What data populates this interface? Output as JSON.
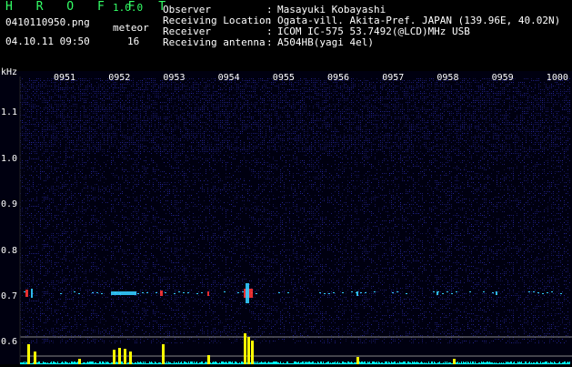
{
  "header": {
    "app_title": "H R O F F T",
    "version": "1.0.0",
    "filename": "0410110950.png",
    "datetime": "04.10.11 09:50",
    "meteor_label": "meteor",
    "meteor_count": "16"
  },
  "metadata": [
    {
      "key": "Observer",
      "colon": ":",
      "value": "Masayuki Kobayashi"
    },
    {
      "key": "Receiving Location",
      "colon": ":",
      "value": "Ogata-vill. Akita-Pref. JAPAN (139.96E, 40.02N)"
    },
    {
      "key": "Receiver",
      "colon": ":",
      "value": "ICOM IC-575 53.7492(@LCD)MHz USB"
    },
    {
      "key": "Receiving antenna",
      "colon": ":",
      "value": "A504HB(yagi 4el)"
    }
  ],
  "spectrogram": {
    "y_unit": "kHz",
    "y_ticks": [
      "1.1",
      "1.0",
      "0.9",
      "0.8",
      "0.7",
      "0.6"
    ],
    "x_ticks": [
      "0951",
      "0952",
      "0953",
      "0954",
      "0955",
      "0956",
      "0957",
      "0958",
      "0959",
      "1000"
    ],
    "colors": {
      "background": "#000010",
      "noise": "#1a1a7a",
      "echo": "#33ccff",
      "strong_echo": "#ff3333",
      "bar": "#ffff00",
      "signal_strength": "#00ffff"
    }
  }
}
